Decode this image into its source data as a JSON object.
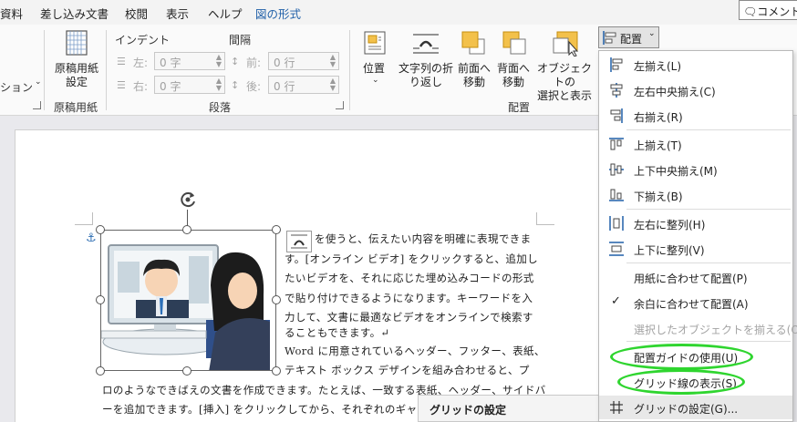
{
  "tabs": [
    "資料",
    "差し込み文書",
    "校閲",
    "表示",
    "ヘルプ",
    "図の形式"
  ],
  "comment_button": "コメント",
  "ribbon": {
    "partial_label": "ション",
    "genko": {
      "label": "原稿用紙\n設定",
      "group": "原稿用紙"
    },
    "indent": {
      "title": "インデント",
      "left_label": "左:",
      "left_value": "0 字",
      "right_label": "右:",
      "right_value": "0 字"
    },
    "spacing": {
      "title": "間隔",
      "before_label": "前:",
      "before_value": "0 行",
      "after_label": "後:",
      "after_value": "0 行"
    },
    "paragraph_group": "段落",
    "arrange_buttons": [
      {
        "label": "位置"
      },
      {
        "label": "文字列の折\nり返し"
      },
      {
        "label": "前面へ\n移動"
      },
      {
        "label": "背面へ\n移動"
      },
      {
        "label": "オブジェクトの\n選択と表示"
      }
    ],
    "arrange_group": "配置",
    "align_button": "配置"
  },
  "menu": {
    "items": [
      {
        "label": "左揃え(L)",
        "icon": "align-left-icon"
      },
      {
        "label": "左右中央揃え(C)",
        "icon": "align-center-icon"
      },
      {
        "label": "右揃え(R)",
        "icon": "align-right-icon"
      },
      {
        "label": "上揃え(T)",
        "icon": "align-top-icon"
      },
      {
        "label": "上下中央揃え(M)",
        "icon": "align-middle-icon"
      },
      {
        "label": "下揃え(B)",
        "icon": "align-bottom-icon"
      },
      {
        "label": "左右に整列(H)",
        "icon": "distribute-horizontal-icon"
      },
      {
        "label": "上下に整列(V)",
        "icon": "distribute-vertical-icon"
      },
      {
        "label": "用紙に合わせて配置(P)"
      },
      {
        "label": "余白に合わせて配置(A)",
        "checked": true
      },
      {
        "label": "選択したオブジェクトを揃える(O)",
        "disabled": true
      },
      {
        "label": "配置ガイドの使用(U)"
      },
      {
        "label": "グリッド線の表示(S)"
      },
      {
        "label": "グリッドの設定(G)...",
        "icon": "grid-icon"
      }
    ]
  },
  "tooltip": {
    "title": "グリッドの設定"
  },
  "document": {
    "lines": [
      "を使うと、伝えたい内容を明確に表現できま",
      "す。[オンライン ビデオ] をクリックすると、追加し",
      "たいビデオを、それに応じた埋め込みコードの形式",
      "で貼り付けできるようになります。キーワードを入",
      "力して、文書に最適なビデオをオンラインで検索す",
      "ることもできます。↵",
      "Word に用意されているヘッダー、フッター、表紙、",
      "テキスト ボックス デザインを組み合わせると、プ",
      "ロのようなできばえの文書を作成できます。たとえば、一致する表紙、ヘッダー、サイドバ",
      "ーを追加できます。[挿入] をクリックしてから、それぞれのギャ"
    ]
  },
  "colors": {
    "accent": "#1f5fa8",
    "highlight_ring": "#2fd52f"
  }
}
